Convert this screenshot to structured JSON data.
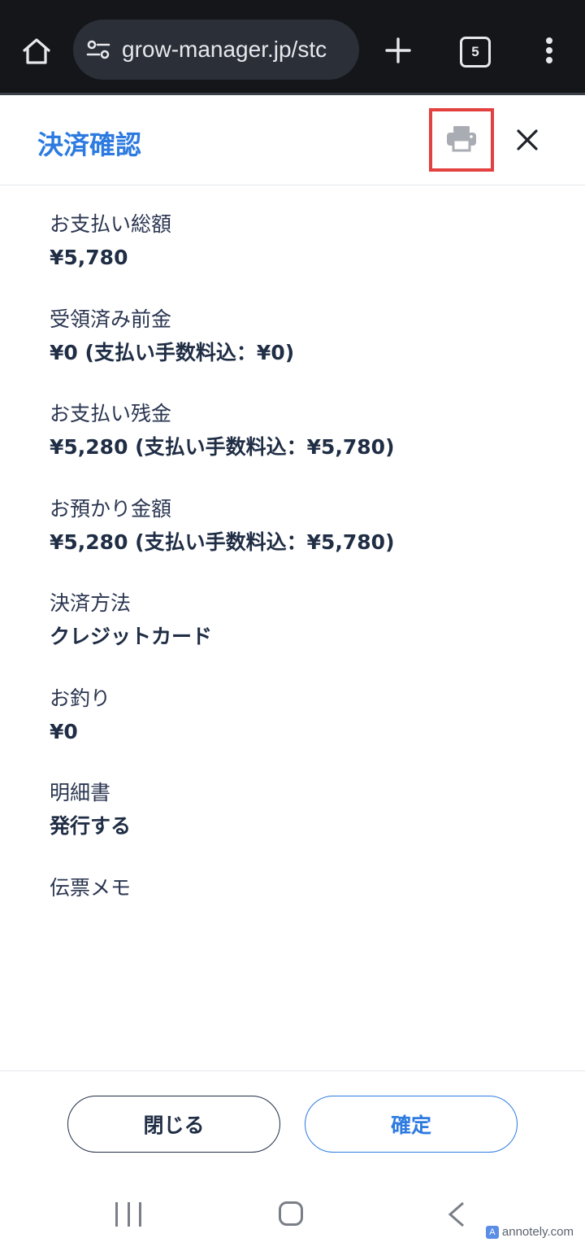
{
  "browser": {
    "url": "grow-manager.jp/stc",
    "tab_count": "5"
  },
  "modal": {
    "title": "決済確認"
  },
  "fields": [
    {
      "label": "お支払い総額",
      "value": "¥5,780"
    },
    {
      "label": "受領済み前金",
      "value": "¥0 (支払い手数料込：¥0)"
    },
    {
      "label": "お支払い残金",
      "value": "¥5,280 (支払い手数料込：¥5,780)"
    },
    {
      "label": "お預かり金額",
      "value": "¥5,280 (支払い手数料込：¥5,780)"
    },
    {
      "label": "決済方法",
      "value": "クレジットカード"
    },
    {
      "label": "お釣り",
      "value": "¥0"
    },
    {
      "label": "明細書",
      "value": "発行する"
    },
    {
      "label": "伝票メモ",
      "value": ""
    }
  ],
  "footer": {
    "close_label": "閉じる",
    "confirm_label": "確定"
  },
  "watermark": "annotely.com",
  "colors": {
    "accent": "#2d7be0",
    "highlight_box": "#e34040",
    "text_primary": "#1f2d45"
  }
}
